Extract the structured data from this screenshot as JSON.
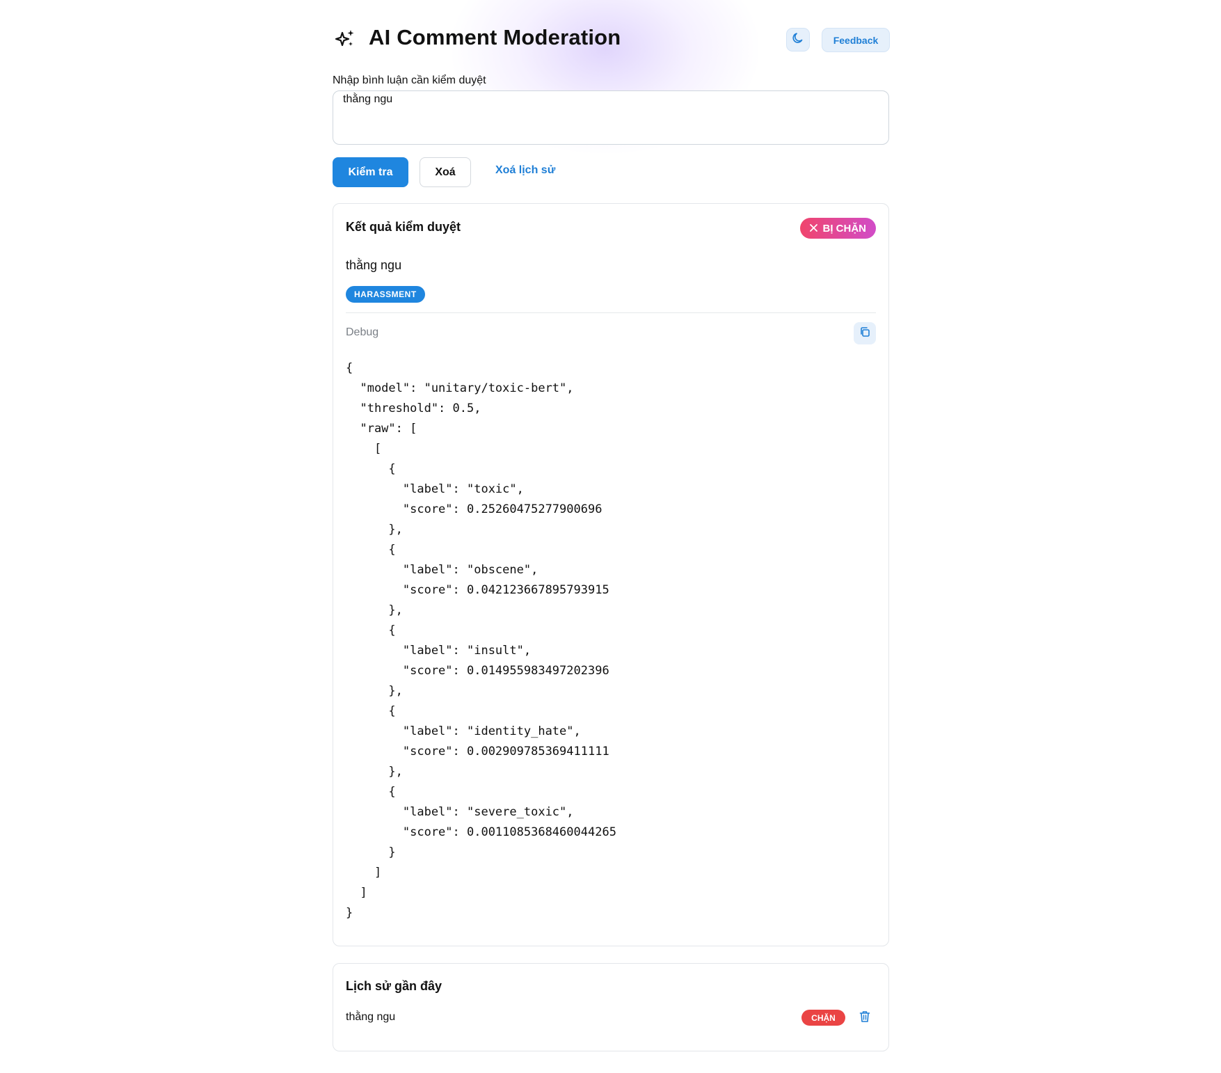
{
  "header": {
    "title": "AI Comment Moderation",
    "brand_icon": "sparkles-icon",
    "theme_icon": "moon-icon",
    "feedback_label": "Feedback"
  },
  "form": {
    "label": "Nhập bình luận cần kiểm duyệt",
    "value": "thằng ngu",
    "check_label": "Kiểm tra",
    "clear_label": "Xoá",
    "clear_history_label": "Xoá lịch sử"
  },
  "result": {
    "title": "Kết quả kiểm duyệt",
    "status_label": "BỊ CHẶN",
    "status_icon": "close-icon",
    "comment": "thằng ngu",
    "tag": "HARASSMENT",
    "debug_label": "Debug",
    "copy_icon": "copy-icon",
    "debug_json": "{\n  \"model\": \"unitary/toxic-bert\",\n  \"threshold\": 0.5,\n  \"raw\": [\n    [\n      {\n        \"label\": \"toxic\",\n        \"score\": 0.25260475277900696\n      },\n      {\n        \"label\": \"obscene\",\n        \"score\": 0.042123667895793915\n      },\n      {\n        \"label\": \"insult\",\n        \"score\": 0.014955983497202396\n      },\n      {\n        \"label\": \"identity_hate\",\n        \"score\": 0.002909785369411111\n      },\n      {\n        \"label\": \"severe_toxic\",\n        \"score\": 0.0011085368460044265\n      }\n    ]\n  ]\n}"
  },
  "history": {
    "title": "Lịch sử gần đây",
    "items": [
      {
        "text": "thằng ngu",
        "badge": "CHẶN",
        "delete_icon": "trash-icon"
      }
    ]
  },
  "colors": {
    "primary": "#1f86df",
    "blocked_gradient_start": "#f0446c",
    "blocked_gradient_end": "#d14cc8",
    "history_badge": "#ea4444"
  }
}
